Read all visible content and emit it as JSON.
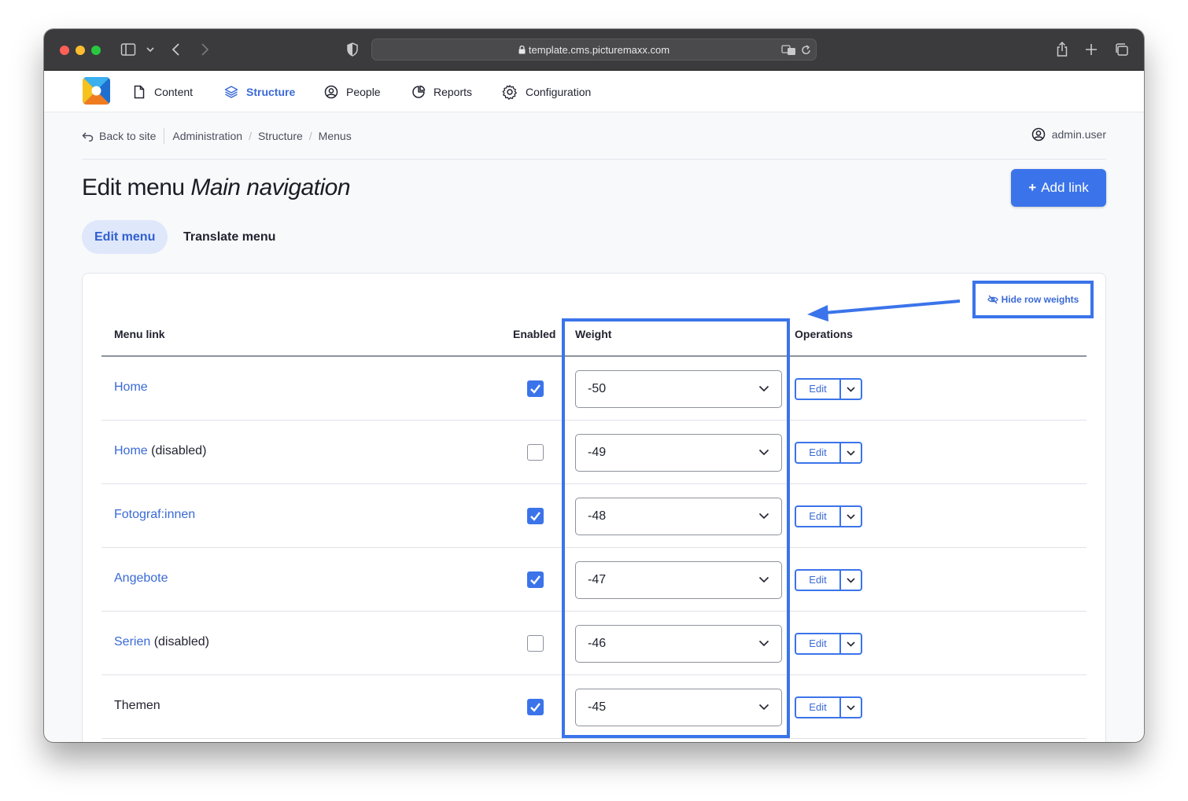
{
  "browser": {
    "url": "template.cms.picturemaxx.com"
  },
  "nav": {
    "items": [
      {
        "label": "Content",
        "icon": "file-icon"
      },
      {
        "label": "Structure",
        "icon": "layers-icon",
        "active": true
      },
      {
        "label": "People",
        "icon": "user-circle-icon"
      },
      {
        "label": "Reports",
        "icon": "pie-chart-icon"
      },
      {
        "label": "Configuration",
        "icon": "gear-icon"
      }
    ]
  },
  "breadcrumb": {
    "back": "Back to site",
    "items": [
      "Administration",
      "Structure",
      "Menus"
    ]
  },
  "user": {
    "name": "admin.user"
  },
  "page": {
    "title_prefix": "Edit menu",
    "title_menu": "Main navigation",
    "add_link": "Add link",
    "add_plus": "+"
  },
  "tabs": [
    "Edit menu",
    "Translate menu"
  ],
  "table": {
    "hide_weights": "Hide row weights",
    "headers": {
      "link": "Menu link",
      "enabled": "Enabled",
      "weight": "Weight",
      "operations": "Operations"
    },
    "rows": [
      {
        "title": "Home",
        "suffix": "",
        "linked": true,
        "enabled": true,
        "weight": "-50",
        "op": "Edit"
      },
      {
        "title": "Home",
        "suffix": " (disabled)",
        "linked": true,
        "enabled": false,
        "weight": "-49",
        "op": "Edit"
      },
      {
        "title": "Fotograf:innen",
        "suffix": "",
        "linked": true,
        "enabled": true,
        "weight": "-48",
        "op": "Edit"
      },
      {
        "title": "Angebote",
        "suffix": "",
        "linked": true,
        "enabled": true,
        "weight": "-47",
        "op": "Edit"
      },
      {
        "title": "Serien",
        "suffix": " (disabled)",
        "linked": true,
        "enabled": false,
        "weight": "-46",
        "op": "Edit"
      },
      {
        "title": "Themen",
        "suffix": "",
        "linked": false,
        "enabled": true,
        "weight": "-45",
        "op": "Edit"
      }
    ]
  },
  "colors": {
    "accent": "#3b74ea",
    "link": "#3a6ad6",
    "chrome": "#3b3b3d"
  }
}
